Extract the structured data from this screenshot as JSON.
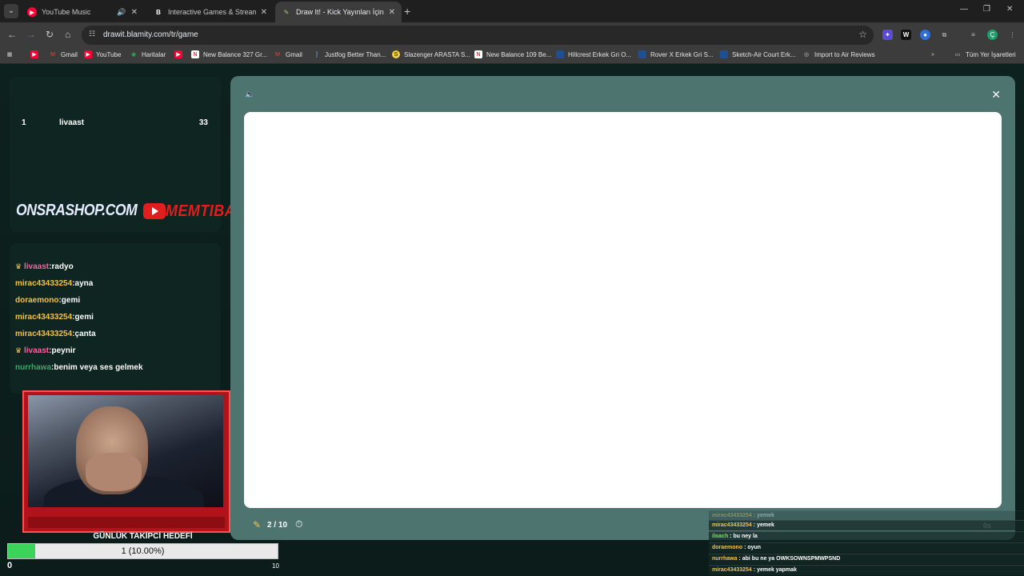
{
  "browser": {
    "tabs": [
      {
        "title": "YouTube Music",
        "icon": "youtube-music-icon",
        "audio": true
      },
      {
        "title": "Interactive Games & Streaming",
        "icon": "blamity-icon"
      },
      {
        "title": "Draw It! - Kick Yayınları İçin Çizi",
        "icon": "pencil-icon",
        "active": true
      }
    ],
    "url": "drawit.blamity.com/tr/game",
    "bookmarks": [
      {
        "label": "",
        "icon": "youtube-icon"
      },
      {
        "label": "Gmail",
        "icon": "gmail-icon"
      },
      {
        "label": "YouTube",
        "icon": "youtube-icon"
      },
      {
        "label": "Haritalar",
        "icon": "maps-icon"
      },
      {
        "label": "",
        "icon": "youtube-icon"
      },
      {
        "label": "New Balance 327 Gr...",
        "icon": "newbalance-icon"
      },
      {
        "label": "Gmail",
        "icon": "gmail-icon"
      },
      {
        "label": "Justfog Better Than...",
        "icon": "justfog-icon"
      },
      {
        "label": "Slazenger ARASTA S...",
        "icon": "slazenger-icon"
      },
      {
        "label": "New Balance 109 Be...",
        "icon": "newbalance-icon"
      },
      {
        "label": "Hillcrest Erkek Gri O...",
        "icon": "shop-icon"
      },
      {
        "label": "Rover X Erkek Gri S...",
        "icon": "shop-icon"
      },
      {
        "label": "Sketch-Air Court Erk...",
        "icon": "shop-icon"
      },
      {
        "label": "Import to Air Reviews",
        "icon": "globe-icon"
      }
    ],
    "all_bookmarks": "Tüm Yer İşaretleri"
  },
  "leaderboard": {
    "rank": "1",
    "name": "livaast",
    "score": "33"
  },
  "overlay": {
    "brand": "ONSRASHOP.COM",
    "channel": "MEMTIBAS"
  },
  "chat": [
    {
      "user": "livaast",
      "text": "radyo",
      "crown": true
    },
    {
      "user": "mirac43433254",
      "text": "ayna"
    },
    {
      "user": "doraemono",
      "text": "gemi"
    },
    {
      "user": "mirac43433254",
      "text": "gemi"
    },
    {
      "user": "mirac43433254",
      "text": "çanta"
    },
    {
      "user": "livaast",
      "text": "peynir",
      "crown": true
    },
    {
      "user": "nurrhawa",
      "text": "benim veya ses gelmek"
    }
  ],
  "goal": {
    "title": "GÜNLÜK TAKİPCİ HEDEFİ",
    "text": "1 (10.00%)",
    "fraction": 0.1,
    "min": "0",
    "max": "10"
  },
  "game": {
    "round": "2 / 10",
    "timer": "0s"
  },
  "guess_feed": [
    {
      "user": "mirac43433254",
      "text": "yemek",
      "faded": true
    },
    {
      "user": "mirac43433254",
      "text": "yemek"
    },
    {
      "user": "iloach",
      "text": "bu ney la",
      "green": true
    },
    {
      "user": "doraemono",
      "text": "oyun"
    },
    {
      "user": "nurrhawa",
      "text": "abi bu ne ya OWKSOWNSPMWPSND"
    },
    {
      "user": "mirac43433254",
      "text": "yemek yapmak"
    }
  ]
}
